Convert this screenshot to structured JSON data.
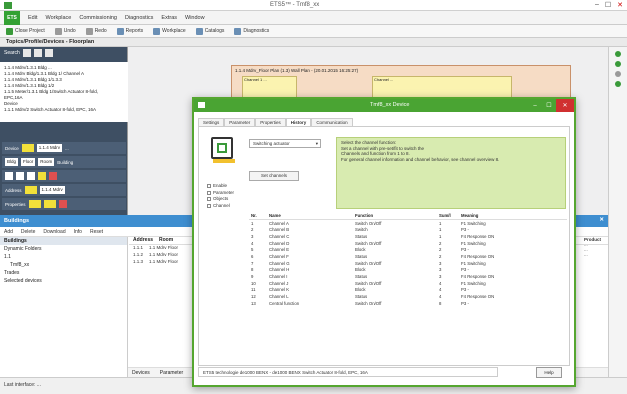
{
  "app": {
    "title": "ETS5™ - Tmf8_xx"
  },
  "window_controls": [
    "‒",
    "☐",
    "✕"
  ],
  "menu": {
    "ets_label": "ETS",
    "items": [
      "Edit",
      "Workplace",
      "Commissioning",
      "Diagnostics",
      "Extras",
      "Window"
    ]
  },
  "toolbar": {
    "items": [
      "Close Project",
      "Undo",
      "Redo",
      "Reports",
      "Workplace",
      "Catalogs",
      "Diagnostics"
    ]
  },
  "crumb": "Topics/Profile/Devices - Floorplan",
  "left_pane": {
    "head": "Search",
    "info_lines": [
      "1.1.4 Mdrv/1.3.1 Bldg ...",
      "1.1.4 Mdrv Bldg/1.3.1 Bldg 1/ Channel A",
      "1.1.4 Mdrv/1.3.1 Bldg 1/1.3.3",
      "1.1.4 Mdrv/1.3.1 Bldg 1/2",
      "1.1.5 Meter/1.3.1 Bldg 1/Switch Actuator 8-fold,",
      "EPC,16A",
      "Device",
      "1.1.1 Mdrv/2 Switch Actuator 8-fold, EPC, 16A"
    ],
    "row1": {
      "label": "Device",
      "value": "1.1.4 Mdrv",
      "extra": "..."
    },
    "row2": {
      "a": "Bldg",
      "b": "Floor",
      "c": "Room",
      "d": "Building"
    },
    "row3": {
      "label": "Address",
      "value": "1.1.4 Mdrv"
    },
    "row4": {
      "label": "Properties"
    }
  },
  "diagram": {
    "frame_title": "1.1.4 Mdrv_Floor Plan (1.3) Wall Plan - (20.01.2015 16:25:27)",
    "inner1": "Channel 1 ...",
    "inner2": "Channel ..."
  },
  "bottom_window": {
    "title": "Buildings",
    "close": "✕",
    "tools": [
      "Add",
      "Delete",
      "Download",
      "Info",
      "Reset"
    ],
    "tree_head": "Buildings",
    "tree": [
      "Dynamic Folders",
      "1.1",
      "Tmf8_xx",
      "Trades",
      "Selected devices"
    ],
    "columns": [
      "Address",
      "Room"
    ],
    "rows": [
      [
        "1.1.1",
        "1.1 Mdrv Floor"
      ],
      [
        "1.1.2",
        "1.1 Mdrv Floor"
      ],
      [
        "1.1.3",
        "1.1 Mdrv Floor"
      ]
    ],
    "footer": [
      "Devices",
      "Parameter"
    ],
    "right_cols": [
      "Product",
      "...",
      "...",
      "..."
    ]
  },
  "statusbar": {
    "left": "Last interface: ..."
  },
  "dialog": {
    "title": "Tmf8_xx Device",
    "tabs": [
      "Settings",
      "Parameter",
      "Properties",
      "History",
      "Communication"
    ],
    "active_tab": 3,
    "param_select": "Switching actuator",
    "param_button": "Set channels",
    "side_list": [
      "Enable",
      "Parameter",
      "Objects",
      "Channel"
    ],
    "info_lines": [
      "Select the channel function:",
      "Set a channel with pre-set/fit to switch the",
      "Channels and function from 1 to 8.",
      "For general channel information and channel behavior, see channel overview 8."
    ],
    "table_head": [
      "Nr.",
      "Name",
      "Function",
      "Sum/l",
      "Meaning"
    ],
    "table": [
      [
        "1",
        "Channel A",
        "Switch On/Off",
        "1",
        "F1 Switching"
      ],
      [
        "2",
        "Channel B",
        "Switch",
        "1",
        "P3 - "
      ],
      [
        "3",
        "Channel C",
        "Status",
        "1",
        "F4 Response ON"
      ],
      [
        "4",
        "Channel D",
        "Switch On/Off",
        "2",
        "F1 Switching"
      ],
      [
        "5",
        "Channel E",
        "Block",
        "2",
        "P3 - "
      ],
      [
        "6",
        "Channel F",
        "Status",
        "2",
        "F4 Response ON"
      ],
      [
        "7",
        "Channel G",
        "Switch On/Off",
        "3",
        "F1 Switching"
      ],
      [
        "8",
        "Channel H",
        "Block",
        "3",
        "P3 - "
      ],
      [
        "9",
        "Channel I",
        "Status",
        "3",
        "F4 Response ON"
      ],
      [
        "10",
        "Channel J",
        "Switch On/Off",
        "4",
        "F1 Switching"
      ],
      [
        "11",
        "Channel K",
        "Block",
        "4",
        "P3 - "
      ],
      [
        "12",
        "Channel L",
        "Status",
        "4",
        "F4 Response ON"
      ],
      [
        "13",
        "Central function",
        "Switch On/Off",
        "8",
        "P3 - "
      ]
    ],
    "status": "ETS5 technologie de1000 BENX - de1000 BENX Switch Actuator 8-fold, EPC, 16A",
    "help_button": "Help"
  }
}
